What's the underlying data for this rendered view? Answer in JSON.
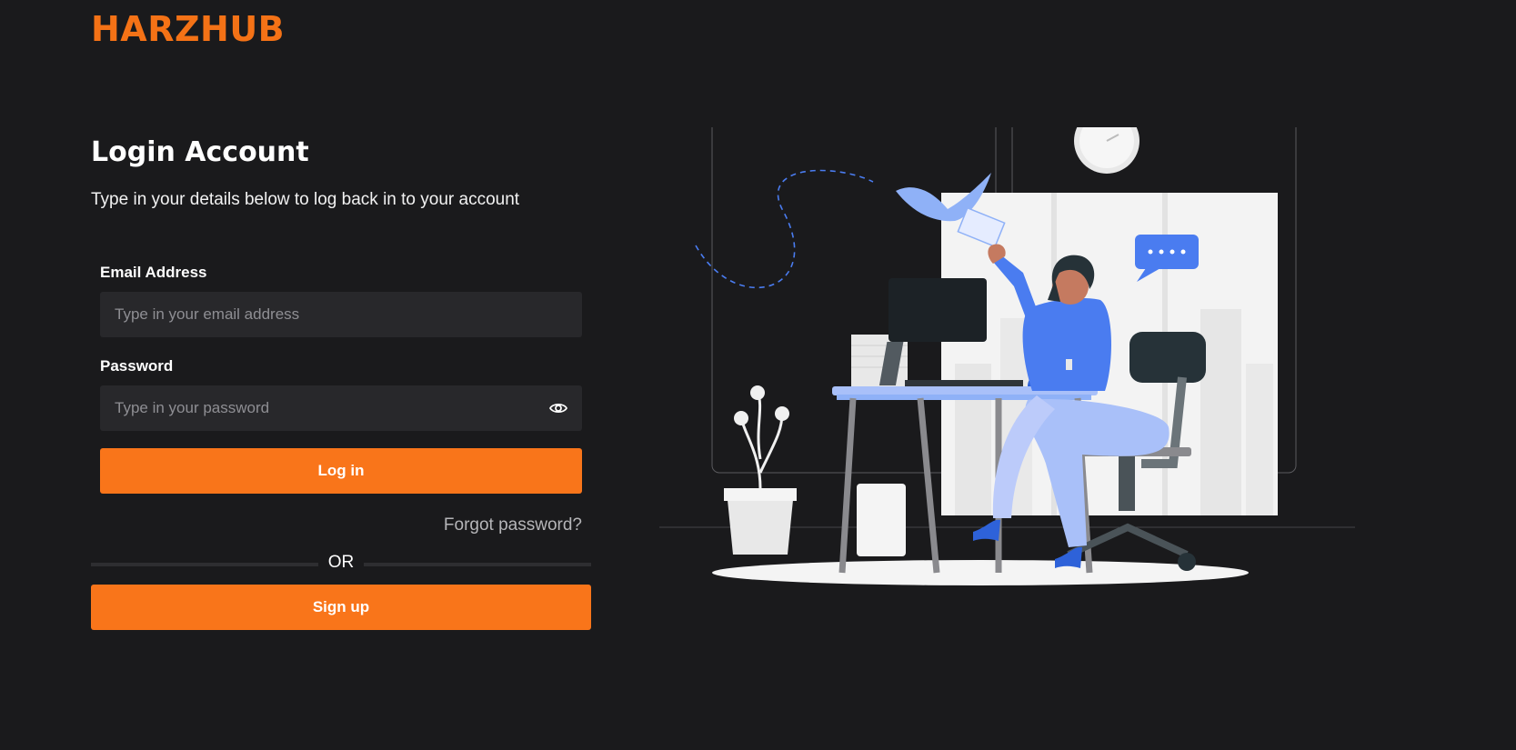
{
  "brand": {
    "name": "HARZHUB",
    "color": "#f47216"
  },
  "login": {
    "title": "Login Account",
    "subtitle": "Type in your details below to log back in to your account",
    "email": {
      "label": "Email Address",
      "placeholder": "Type in your email address",
      "value": ""
    },
    "password": {
      "label": "Password",
      "placeholder": "Type in your password",
      "value": "",
      "toggle_icon": "eye-icon"
    },
    "login_button": "Log in",
    "forgot_link": "Forgot password?",
    "divider": "OR",
    "signup_button": "Sign up"
  },
  "colors": {
    "accent": "#f9751a",
    "background": "#1a1a1c",
    "input_bg": "#28282b",
    "illustration_accent": "#4a7cf0"
  }
}
